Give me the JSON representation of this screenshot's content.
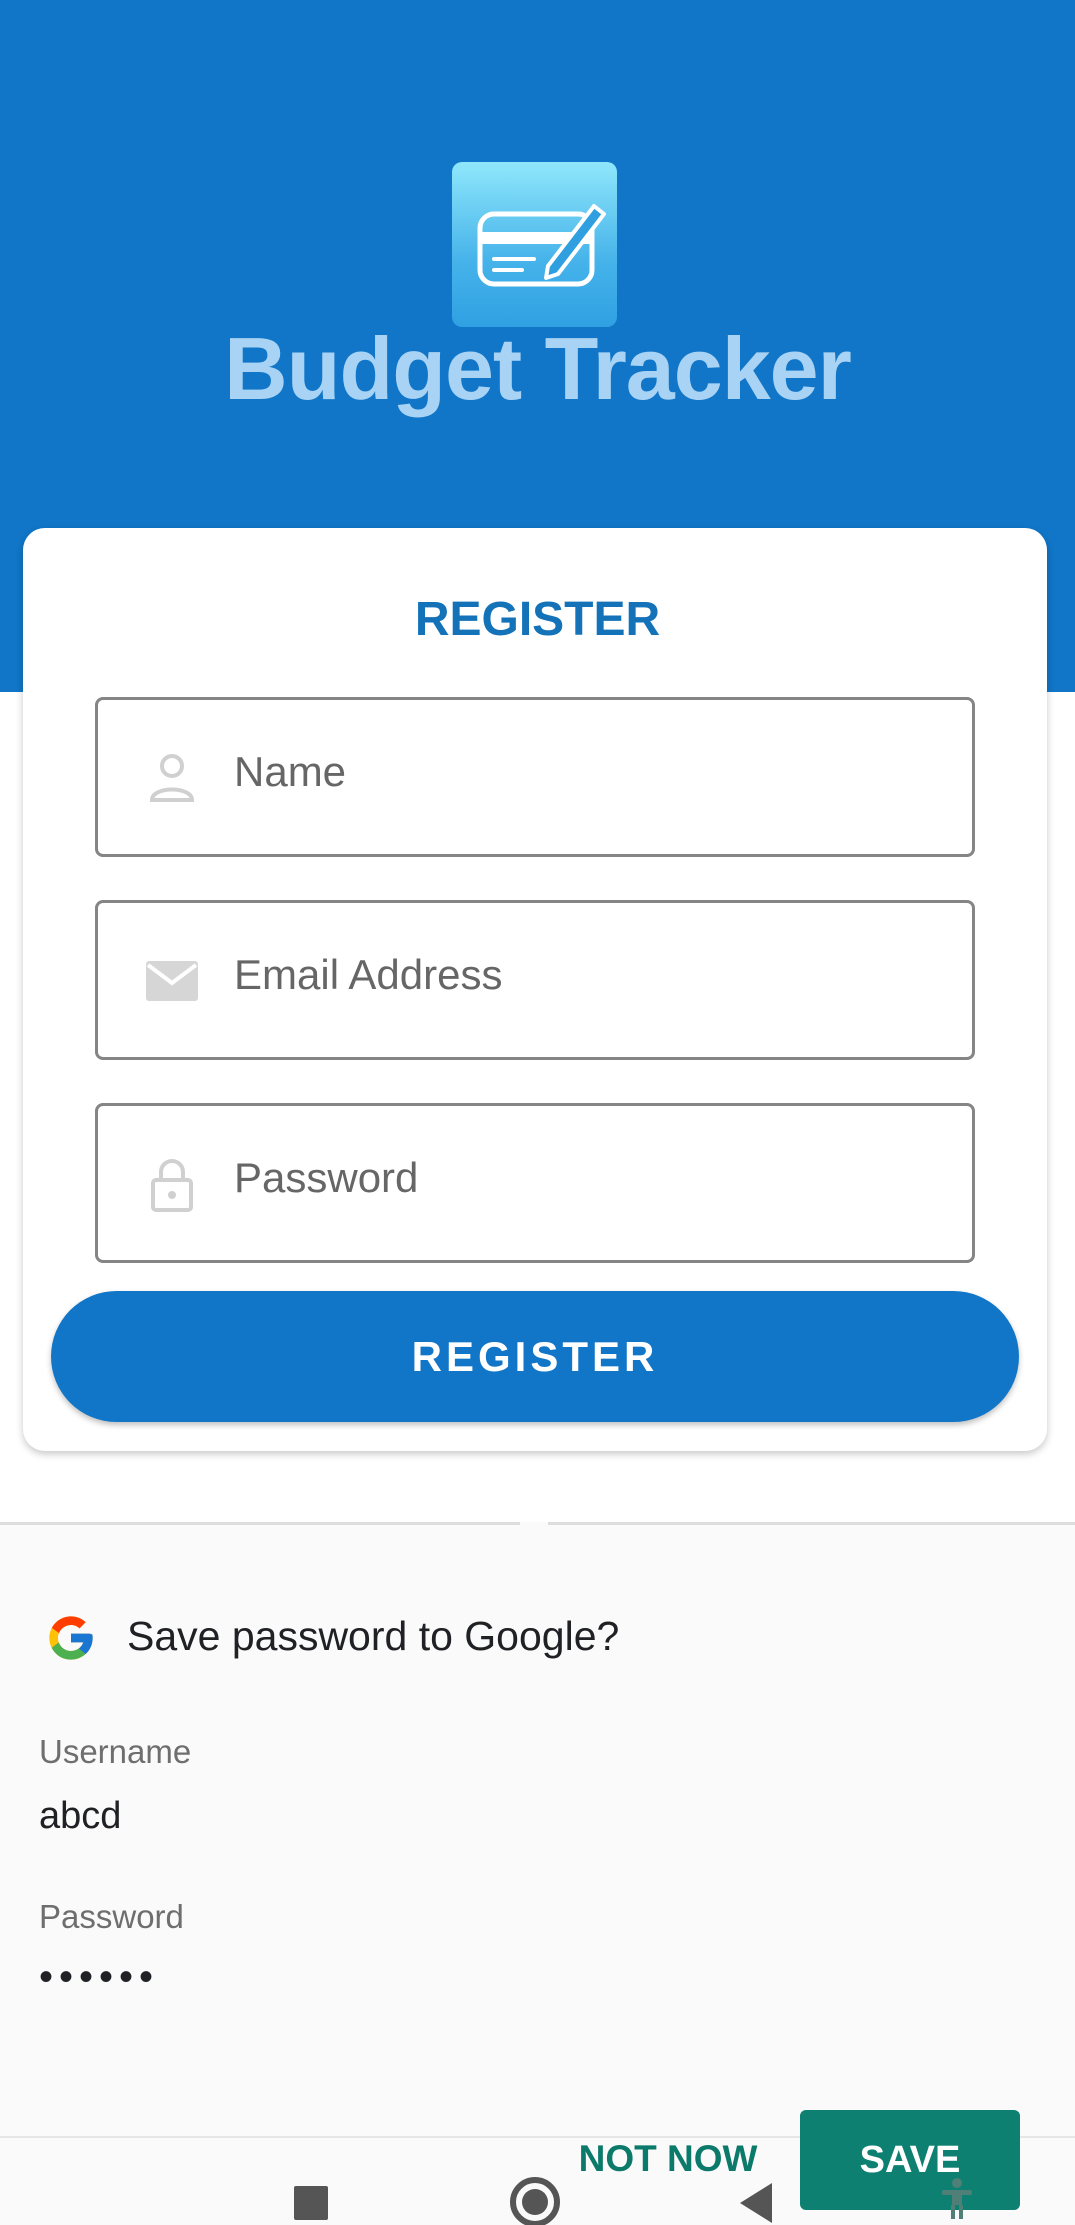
{
  "app": {
    "title": "Budget Tracker",
    "icon": "credit-card-edit-icon"
  },
  "form": {
    "heading": "REGISTER",
    "name_placeholder": "Name",
    "email_placeholder": "Email Address",
    "password_placeholder": "Password",
    "submit_label": "REGISTER"
  },
  "save_prompt": {
    "title": "Save password to Google?",
    "username_label": "Username",
    "username_value": "abcd",
    "password_label": "Password",
    "password_value": "••••••",
    "not_now_label": "NOT NOW",
    "save_label": "SAVE"
  },
  "colors": {
    "primary": "#1176c8",
    "accent_green": "#0d8072"
  },
  "navbar": {
    "icons": [
      "recent-apps-icon",
      "home-icon",
      "back-icon",
      "accessibility-icon"
    ]
  }
}
